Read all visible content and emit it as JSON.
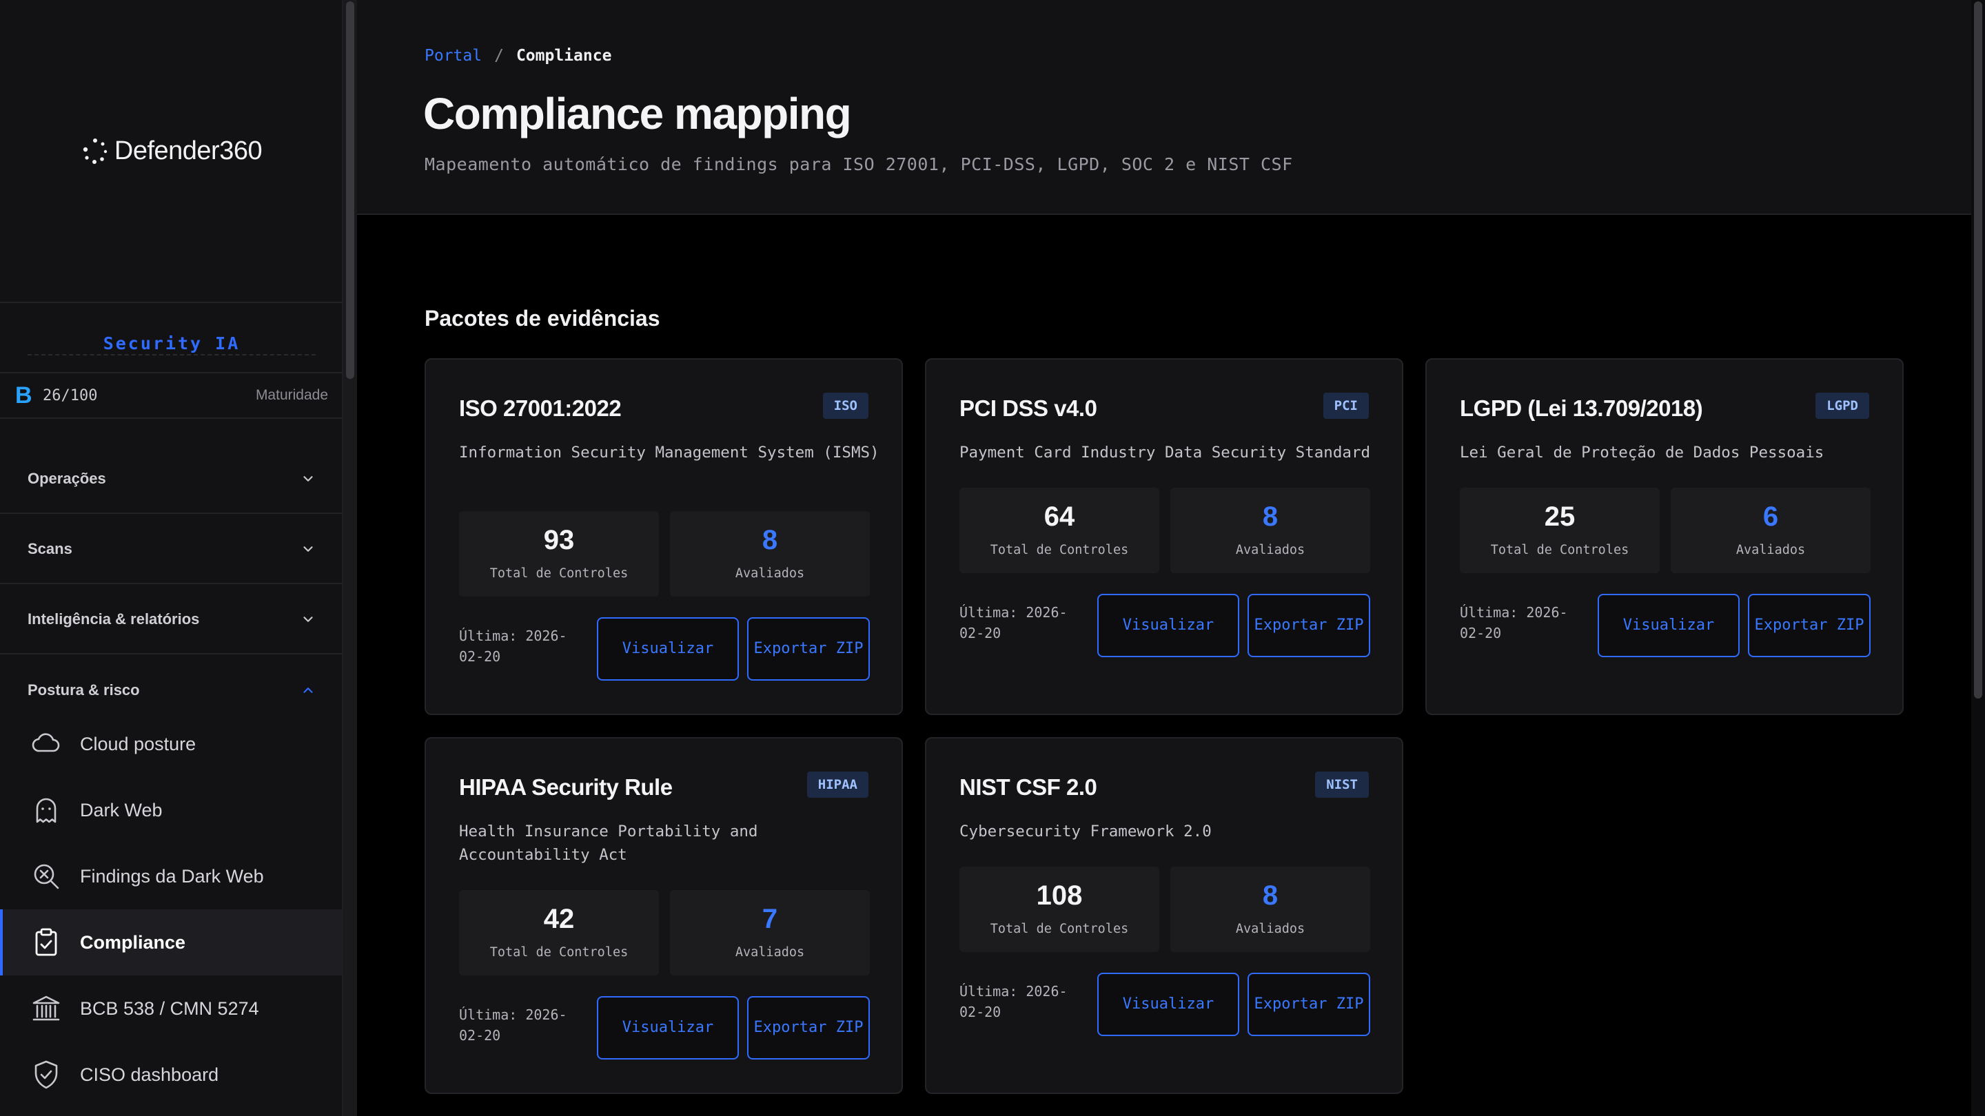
{
  "app": {
    "name": "Defender360"
  },
  "sidebar": {
    "security_label": "Security IA",
    "maturity": {
      "letter": "B",
      "score": "26/100",
      "label": "Maturidade"
    },
    "sections": [
      {
        "label": "Operações"
      },
      {
        "label": "Scans"
      },
      {
        "label": "Inteligência & relatórios"
      },
      {
        "label": "Postura & risco"
      }
    ],
    "items": [
      {
        "label": "Cloud posture",
        "icon": "cloud-icon"
      },
      {
        "label": "Dark Web",
        "icon": "ghost-icon"
      },
      {
        "label": "Findings da Dark Web",
        "icon": "search-x-icon"
      },
      {
        "label": "Compliance",
        "icon": "clipboard-check-icon",
        "active": true
      },
      {
        "label": "BCB 538 / CMN 5274",
        "icon": "bank-icon"
      },
      {
        "label": "CISO dashboard",
        "icon": "shield-check-icon"
      }
    ]
  },
  "header": {
    "breadcrumb": {
      "root": "Portal",
      "separator": "/",
      "current": "Compliance"
    },
    "title": "Compliance mapping",
    "subtitle": "Mapeamento automático de findings para ISO 27001, PCI-DSS, LGPD, SOC 2 e NIST CSF"
  },
  "main": {
    "section_title": "Pacotes de evidências",
    "stat_total_label": "Total de Controles",
    "stat_evaluated_label": "Avaliados",
    "view_label": "Visualizar",
    "export_label": "Exportar ZIP",
    "cards": [
      {
        "title": "ISO 27001:2022",
        "badge": "ISO",
        "description": "Information Security Management System (ISMS)",
        "total": "93",
        "evaluated": "8",
        "last": "Última: 2026-02-20"
      },
      {
        "title": "PCI DSS v4.0",
        "badge": "PCI",
        "description": "Payment Card Industry Data Security Standard",
        "total": "64",
        "evaluated": "8",
        "last": "Última: 2026-02-20"
      },
      {
        "title": "LGPD (Lei 13.709/2018)",
        "badge": "LGPD",
        "description": "Lei Geral de Proteção de Dados Pessoais",
        "total": "25",
        "evaluated": "6",
        "last": "Última: 2026-02-20"
      },
      {
        "title": "HIPAA Security Rule",
        "badge": "HIPAA",
        "description": "Health Insurance Portability and Accountability Act",
        "total": "42",
        "evaluated": "7",
        "last": "Última: 2026-02-20"
      },
      {
        "title": "NIST CSF 2.0",
        "badge": "NIST",
        "description": "Cybersecurity Framework 2.0",
        "total": "108",
        "evaluated": "8",
        "last": "Última: 2026-02-20"
      }
    ]
  },
  "colors": {
    "accent": "#2f6bff",
    "maturity": "#29a3ff",
    "background": "#000000",
    "panel": "#121214"
  }
}
